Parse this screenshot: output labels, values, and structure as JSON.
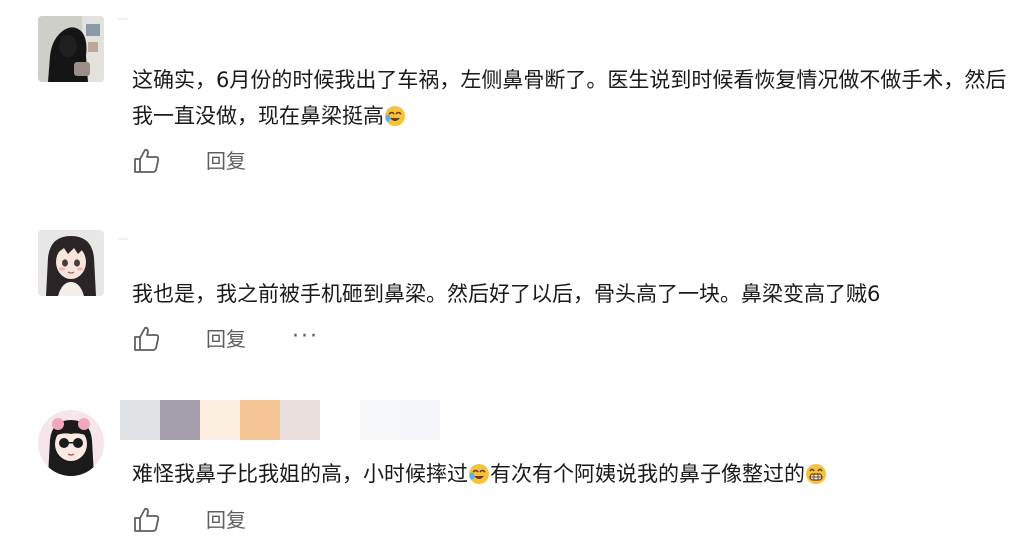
{
  "comments": [
    {
      "text": "这确实，6月份的时候我出了车祸，左侧鼻骨断了。医生说到时候看恢复情况做不做手术，然后我一直没做，现在鼻梁挺高",
      "trailing_emoji": "laughing-tears-emoji",
      "reply_label": "回复",
      "show_more": false
    },
    {
      "text": "我也是，我之前被手机砸到鼻梁。然后好了以后，骨头高了一块。鼻梁变高了贼6",
      "reply_label": "回复",
      "show_more": true,
      "more_label": "···"
    },
    {
      "text_before_emoji": "难怪我鼻子比我姐的高，小时候摔过",
      "inline_emoji": "laughing-tears-emoji",
      "text_after_emoji": "有次有个阿姨说我的鼻子像整过的",
      "trailing_emoji": "grinning-emoji",
      "reply_label": "回复",
      "show_more": false
    }
  ],
  "colors": {
    "text": "#1a1a1a",
    "action_gray": "#5f5f5f",
    "emoji_yellow": "#f7c23b",
    "mosaic": [
      "#dfe3e6",
      "#a59fab",
      "#fbeee0",
      "#f6c595",
      "#eadfdc",
      "#f7f8fa",
      "#f5f6fa"
    ]
  },
  "icons": {
    "like": "thumbs-up-outline-icon"
  }
}
